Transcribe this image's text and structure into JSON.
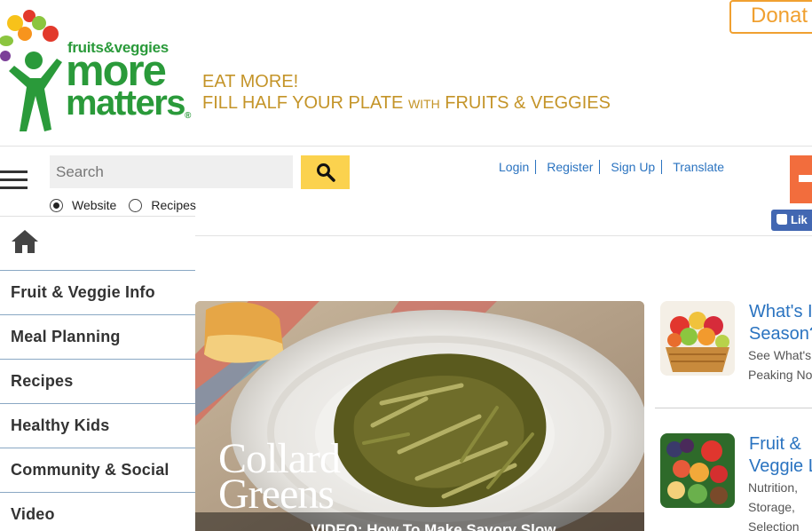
{
  "logo": {
    "line1": "fruits&veggies",
    "line2": "more",
    "line3": "matters",
    "registered": "®"
  },
  "tagline": {
    "line1": "EAT MORE!",
    "line2_a": "FILL HALF YOUR PLATE ",
    "line2_b": "WITH",
    "line2_c": " FRUITS & VEGGIES"
  },
  "donate_label": "Donat",
  "search": {
    "placeholder": "Search",
    "options": [
      {
        "label": "Website",
        "selected": true
      },
      {
        "label": "Recipes",
        "selected": false
      }
    ]
  },
  "user_links": [
    "Login",
    "Register",
    "Sign Up",
    "Translate"
  ],
  "fb_like_label": "Lik",
  "nav": {
    "items": [
      "Fruit & Veggie Info",
      "Meal Planning",
      "Recipes",
      "Healthy Kids",
      "Community & Social",
      "Video"
    ]
  },
  "hero": {
    "title_line1": "Collard",
    "title_line2": "Greens",
    "caption": "VIDEO: How To Make Savory Slow"
  },
  "cards": [
    {
      "title_l1": "What's I",
      "title_l2": "Season?",
      "desc_l1": "See What's",
      "desc_l2": "Peaking No"
    },
    {
      "title_l1": "Fruit &",
      "title_l2": "Veggie L",
      "desc_l1": "Nutrition,",
      "desc_l2": "Storage,",
      "desc_l3": "Selection"
    }
  ],
  "colors": {
    "brand_green": "#2a9a3a",
    "tagline_gold": "#c49428",
    "link_blue": "#2a73c0",
    "search_yellow": "#fbd24e",
    "donate_orange": "#f0a030"
  }
}
